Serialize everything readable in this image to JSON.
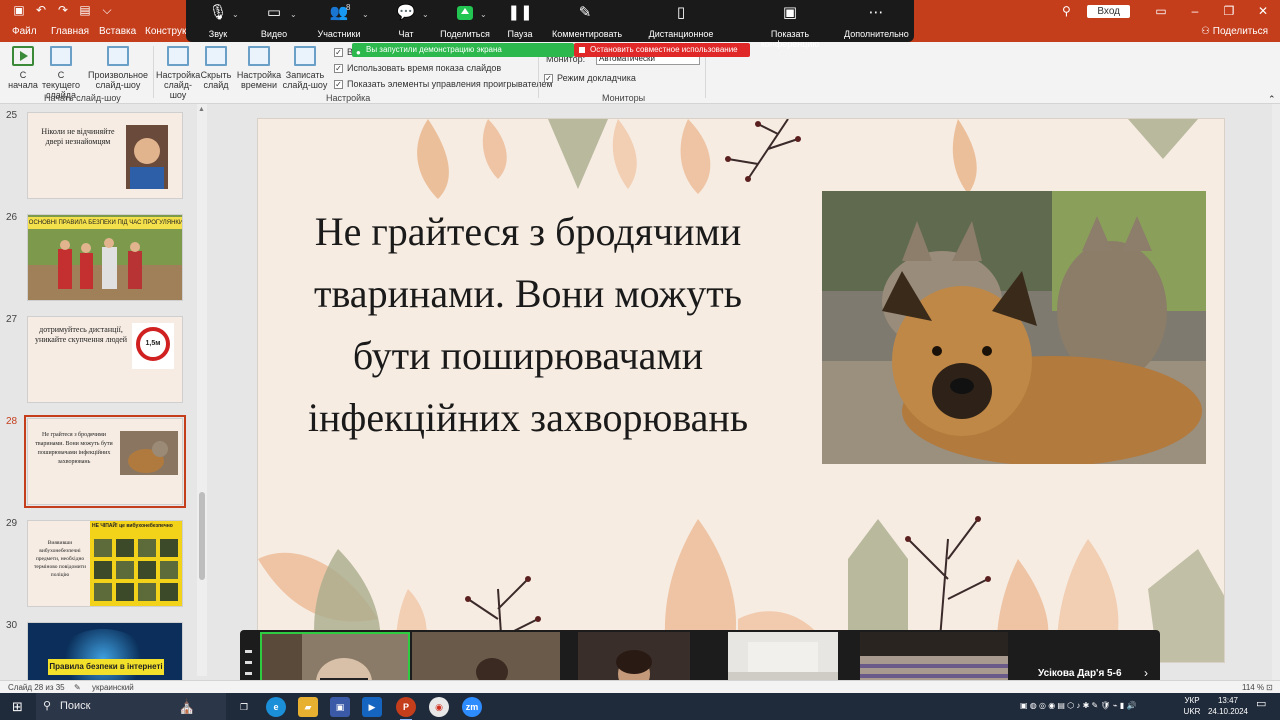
{
  "titlebar": {
    "login_label": "Вход",
    "qat_icons": [
      "save-icon",
      "undo-icon",
      "redo-icon",
      "from-beginning-icon",
      "customize-icon"
    ]
  },
  "tabs": {
    "file": "Файл",
    "home": "Главная",
    "insert": "Вставка",
    "design": "Конструкт",
    "share": "Поделиться"
  },
  "zoom": {
    "audio": "Звук",
    "video": "Видео",
    "participants": "Участники",
    "participants_count": "8",
    "chat": "Чат",
    "share": "Поделиться",
    "pause": "Пауза",
    "annotate": "Комментировать",
    "remote_control": "Дистанционное управление",
    "show_meeting": "Показать конференцию",
    "more": "Дополнительно",
    "sharing_banner": "Вы запустили демонстрацию экрана",
    "stop_sharing": "Остановить совместное использование"
  },
  "ribbon": {
    "from_beginning": "С начала",
    "from_current": "С текущего слайда",
    "custom_show": "Произвольное слайд-шоу",
    "group_start": "Начать слайд-шоу",
    "setup_show": "Настройка слайд-шоу",
    "hide_slide": "Скрыть слайд",
    "rehearse": "Настройка времени",
    "record": "Записать слайд-шоу",
    "group_setup": "Настройка",
    "check_first": "В",
    "use_timings": "Использовать время показа слайдов",
    "show_media_controls": "Показать элементы управления проигрывателем",
    "monitor_label": "Монитор:",
    "monitor_value": "Автоматически",
    "presenter_view": "Режим докладчика",
    "group_monitors": "Мониторы"
  },
  "thumbnails": [
    {
      "num": "25",
      "text": "Ніколи не відчиняйте двері незнайомцям"
    },
    {
      "num": "26",
      "text": "ОСНОВНІ ПРАВИЛА БЕЗПЕКИ ПІД ЧАС ПРОГУЛЯНКИ"
    },
    {
      "num": "27",
      "text": "дотримуйтесь дистанції, уникайте скупчення людей",
      "sign": "1,5м"
    },
    {
      "num": "28",
      "text": "Не грайтеся з бродячими тваринами. Вони можуть бути поширювачами інфекційних захворювань"
    },
    {
      "num": "29",
      "text": "Виявивши вибухонебезпечні предмети, необхідно терміново повідомити поліцію",
      "header": "НЕ ЧІПАЙ! це вибухонебезпечно"
    },
    {
      "num": "30",
      "text": "Правила безпеки в інтернеті"
    }
  ],
  "slide": {
    "text": "Не грайтеся з бродячими тваринами. Вони можуть бути поширювачами інфекційних захворювань"
  },
  "video": {
    "name": "Усікова Дар'я 5-6"
  },
  "status": {
    "slide_of": "Слайд 28 из 35",
    "language": "украинский",
    "zoom": "114 %"
  },
  "taskbar": {
    "search": "Поиск",
    "lang_top": "УКР",
    "lang_bottom": "UKR",
    "time": "13:47",
    "date": "24.10.2024"
  },
  "colors": {
    "accent": "#c43e1c",
    "zoom_bar": "#1a1a1a",
    "share_green": "#2db84d",
    "stop_red": "#e02828",
    "slide_bg": "#f7ece2"
  }
}
